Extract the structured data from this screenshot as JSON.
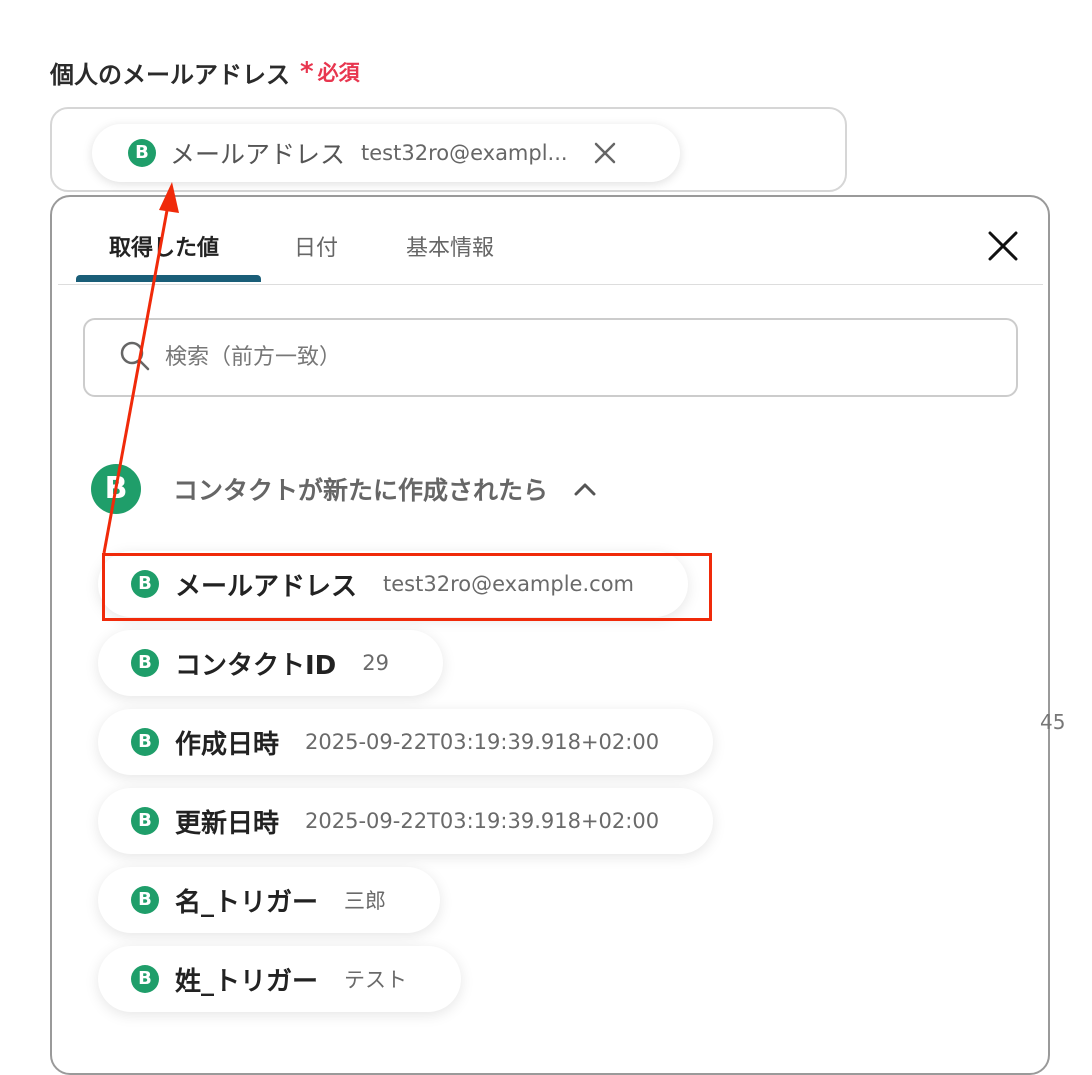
{
  "field": {
    "label": "個人のメールアドレス",
    "required_mark": "*",
    "required_text": "必須"
  },
  "selected_chip": {
    "badge": "B",
    "label": "メールアドレス",
    "value": "test32ro@exampl..."
  },
  "tabs": [
    {
      "label": "取得した値",
      "active": true
    },
    {
      "label": "日付",
      "active": false
    },
    {
      "label": "基本情報",
      "active": false
    }
  ],
  "search": {
    "placeholder": "検索（前方一致）",
    "value": ""
  },
  "group": {
    "badge": "B",
    "title": "コンタクトが新たに作成されたら",
    "expanded": true
  },
  "items": [
    {
      "badge": "B",
      "label": "メールアドレス",
      "value": "test32ro@example.com"
    },
    {
      "badge": "B",
      "label": "コンタクトID",
      "value": "29"
    },
    {
      "badge": "B",
      "label": "作成日時",
      "value": "2025-09-22T03:19:39.918+02:00"
    },
    {
      "badge": "B",
      "label": "更新日時",
      "value": "2025-09-22T03:19:39.918+02:00"
    },
    {
      "badge": "B",
      "label": "名_トリガー",
      "value": "三郎"
    },
    {
      "badge": "B",
      "label": "姓_トリガー",
      "value": "テスト"
    }
  ],
  "edge_text": "45",
  "colors": {
    "accent": "#1a5e78",
    "badge": "#1f9e6a",
    "required": "#e8364f",
    "annotation": "#f02a0a"
  }
}
